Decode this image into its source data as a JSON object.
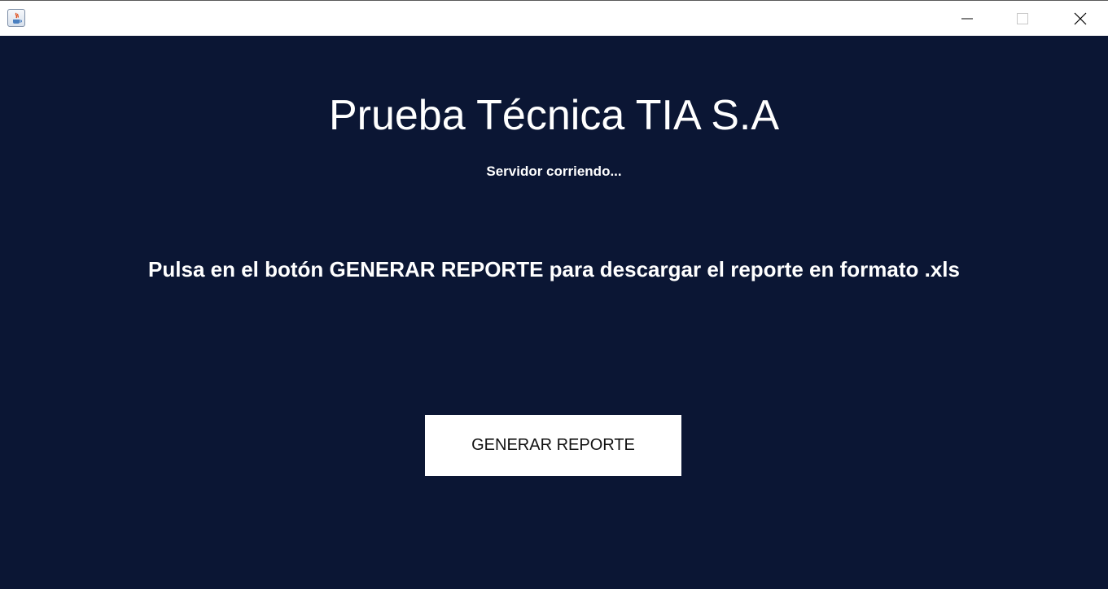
{
  "window": {
    "controls": {
      "minimize_icon": "minimize-icon",
      "maximize_icon": "maximize-icon",
      "close_icon": "close-icon"
    },
    "app_icon": "java-cup-icon"
  },
  "main": {
    "title": "Prueba Técnica TIA S.A",
    "status": "Servidor corriendo...",
    "instruction": "Pulsa en el botón GENERAR REPORTE para descargar el reporte en formato .xls",
    "generate_button_label": "GENERAR REPORTE"
  },
  "colors": {
    "background": "#0b1634",
    "text": "#ffffff",
    "button_bg": "#ffffff",
    "button_text": "#111111"
  }
}
